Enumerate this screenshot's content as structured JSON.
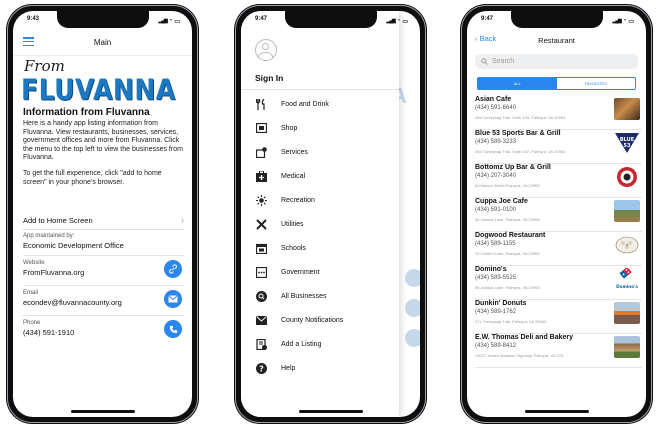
{
  "phone1": {
    "time": "9:43",
    "nav_title": "Main",
    "logo_from": "From",
    "logo_name": "FLUVANNA",
    "heading": "Information from Fluvanna",
    "description": "Here is a handy app listing information from Fluvanna. View restaurants, businesses, services, government offices and more from Fluvanna. Click the menu to the top left to view the businesses from Fluvanna.",
    "tip": "To get the full experience, click \"add to home screen\" in your phone's browser.",
    "add_home": "Add to Home Screen",
    "maintained_label": "App maintained by:",
    "maintained_value": "Economic Development Office",
    "contacts": [
      {
        "label": "Website",
        "value": "FromFluvanna.org",
        "icon": "link-icon"
      },
      {
        "label": "Email",
        "value": "econdev@fluvannacounty.org",
        "icon": "mail-icon"
      },
      {
        "label": "Phone",
        "value": "(434) 591-1910",
        "icon": "phone-icon"
      }
    ]
  },
  "phone2": {
    "time": "9:47",
    "sign_in": "Sign In",
    "menu": [
      {
        "label": "Food and Drink",
        "icon": "utensils-icon"
      },
      {
        "label": "Shop",
        "icon": "shop-icon"
      },
      {
        "label": "Services",
        "icon": "services-icon"
      },
      {
        "label": "Medical",
        "icon": "medical-icon"
      },
      {
        "label": "Recreation",
        "icon": "sun-icon"
      },
      {
        "label": "Utilities",
        "icon": "tools-icon"
      },
      {
        "label": "Schools",
        "icon": "calendar-icon"
      },
      {
        "label": "Government",
        "icon": "ellipsis-box-icon"
      },
      {
        "label": "All Businesses",
        "icon": "search-circle-icon"
      },
      {
        "label": "County Notifications",
        "icon": "envelope-icon"
      },
      {
        "label": "Add a Listing",
        "icon": "add-listing-icon"
      },
      {
        "label": "Help",
        "icon": "help-icon"
      }
    ]
  },
  "phone3": {
    "time": "9:47",
    "back": "Back",
    "nav_title": "Restaurant",
    "search_placeholder": "Search",
    "seg_all": "ALL",
    "seg_fav": "FAVORITES",
    "businesses": [
      {
        "name": "Asian Cafe",
        "phone": "(434) 591-6640",
        "address": "265 Turkeysag Trail, Suite 103, Palmyra, VA 22963",
        "thumb": "asian-cafe-photo"
      },
      {
        "name": "Blue 53 Sports Bar & Grill",
        "phone": "(434) 589-3233",
        "address": "265 Turkeysag Trail, Suite 107, Palmyra, VA 22963",
        "thumb": "blue53-logo"
      },
      {
        "name": "Bottomz Up Bar & Grill",
        "phone": "(434) 207-3040",
        "address": "63 Market Street Palmyra, VA 22963",
        "thumb": "bottomz-up-logo"
      },
      {
        "name": "Cuppa Joe Cafe",
        "phone": "(434) 591-0100",
        "address": "90 Joshua Lane, Palmyra, VA 22963",
        "thumb": "cuppa-joe-photo"
      },
      {
        "name": "Dogwood Restaurant",
        "phone": "(434) 589-1155",
        "address": "10 Centre Court, Palmyra, VA 22963",
        "thumb": "dogwood-logo"
      },
      {
        "name": "Domino's",
        "phone": "(434) 589-5525",
        "address": "86 Joshua Lane, Palmyra, VA 22963",
        "thumb": "dominos-logo"
      },
      {
        "name": "Dunkin' Donuts",
        "phone": "(434) 589-1762",
        "address": "271 Turkeysag Trail, Palmyra, VA 22963",
        "thumb": "dunkin-photo"
      },
      {
        "name": "E.W. Thomas Deli and Bakery",
        "phone": "(434) 589-8412",
        "address": "13027 James Madison Highway, Palmyra, VA 229...",
        "thumb": "ew-thomas-photo"
      }
    ]
  },
  "colors": {
    "accent": "#2b86f0",
    "logo_blue": "#1c78c0"
  }
}
